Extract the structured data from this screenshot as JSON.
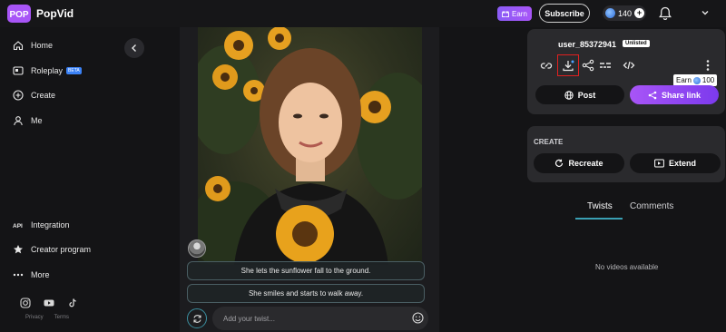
{
  "brand": {
    "logo_text": "POP",
    "name": "PopVid"
  },
  "topbar": {
    "earn_label": "Earn",
    "subscribe_label": "Subscribe",
    "credits": "140"
  },
  "sidebar": {
    "items": [
      {
        "label": "Home",
        "icon": "home-icon"
      },
      {
        "label": "Roleplay",
        "icon": "roleplay-icon",
        "badge": "BETA"
      },
      {
        "label": "Create",
        "icon": "plus-circle-icon"
      },
      {
        "label": "Me",
        "icon": "user-icon"
      },
      {
        "label": "Integration",
        "icon": "api-icon"
      },
      {
        "label": "Creator program",
        "icon": "star-icon"
      },
      {
        "label": "More",
        "icon": "more-icon"
      }
    ],
    "api_glyph": "API",
    "socials": [
      "instagram-icon",
      "youtube-icon",
      "tiktok-icon"
    ],
    "legal": {
      "privacy": "Privacy",
      "terms": "Terms"
    }
  },
  "media": {
    "twists": [
      "She lets the sunflower fall to the ground.",
      "She smiles and starts to walk away."
    ],
    "input_placeholder": "Add your twist..."
  },
  "panel": {
    "username": "user_85372941",
    "visibility_badge": "Unlisted",
    "earn_tooltip": {
      "label": "Earn",
      "amount": "100"
    },
    "post_label": "Post",
    "share_label": "Share link",
    "create_heading": "CREATE",
    "recreate_label": "Recreate",
    "extend_label": "Extend",
    "tabs": [
      "Twists",
      "Comments"
    ],
    "active_tab": "Twists",
    "empty_message": "No videos available"
  },
  "colors": {
    "accent_purple": "#8b5cf6",
    "accent_teal": "#3aa0b4",
    "highlight_red": "#e02020"
  }
}
